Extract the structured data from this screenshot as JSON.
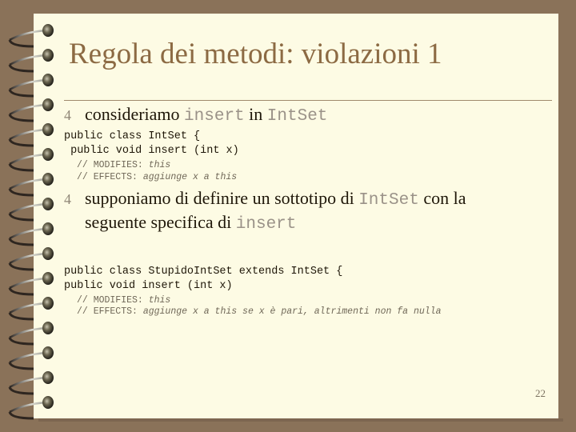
{
  "slide": {
    "title": "Regola dei metodi: violazioni 1",
    "page_number": "22",
    "bullet_glyph": "4",
    "bullet1": {
      "text_a": "consideriamo ",
      "code_a": "insert",
      "text_b": " in ",
      "code_b": "IntSet"
    },
    "code1": {
      "line1": "public class IntSet {",
      "line2": " public void insert (int x)",
      "comment1_prefix": "// MODIFIES: ",
      "comment1_body": "this",
      "comment2_prefix": "// EFFECTS: ",
      "comment2_body": "aggiunge x a this"
    },
    "bullet2": {
      "text_a": "supponiamo di definire un sottotipo di ",
      "code_a": "IntSet",
      "text_b": "  con la",
      "text_c": "seguente specifica di ",
      "code_b": "insert"
    },
    "code2": {
      "line1": "public class StupidoIntSet extends IntSet {",
      "line2": "public void insert (int x)",
      "comment1_prefix": "// MODIFIES: ",
      "comment1_body": "this",
      "comment2_prefix": "// EFFECTS: ",
      "comment2_body": "aggiunge x a this se x è pari, altrimenti non fa nulla"
    }
  }
}
